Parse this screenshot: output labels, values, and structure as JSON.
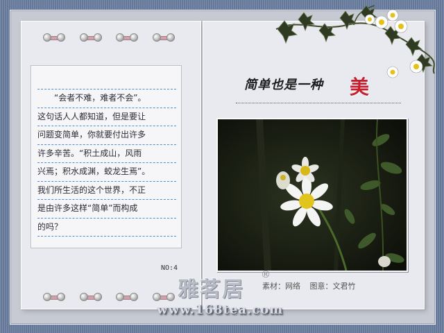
{
  "poem": {
    "lines": [
      "　　“会者不难，难者不会”。",
      "这句话人人都知道，但是要让",
      "问题变简单，你就要付出许多",
      "许多辛苦。“积土成山，风雨",
      "兴焉；积水成渊，蛟龙生焉”。",
      "我们所生活的这个世界，不正",
      "是由许多这样“简单”而构成",
      "的吗？"
    ]
  },
  "page_number": "NO:4",
  "title": {
    "main": "简单也是一种",
    "accent": "美"
  },
  "credits": {
    "material": "素材：网络",
    "design": "图意：文君竹"
  },
  "logo": {
    "text": "雅茗居",
    "mark": "®"
  },
  "site_url": "www.168tea.com",
  "colors": {
    "accent": "#c41f2e",
    "rule": "#4a8fd0",
    "page": "#e9eaef"
  }
}
